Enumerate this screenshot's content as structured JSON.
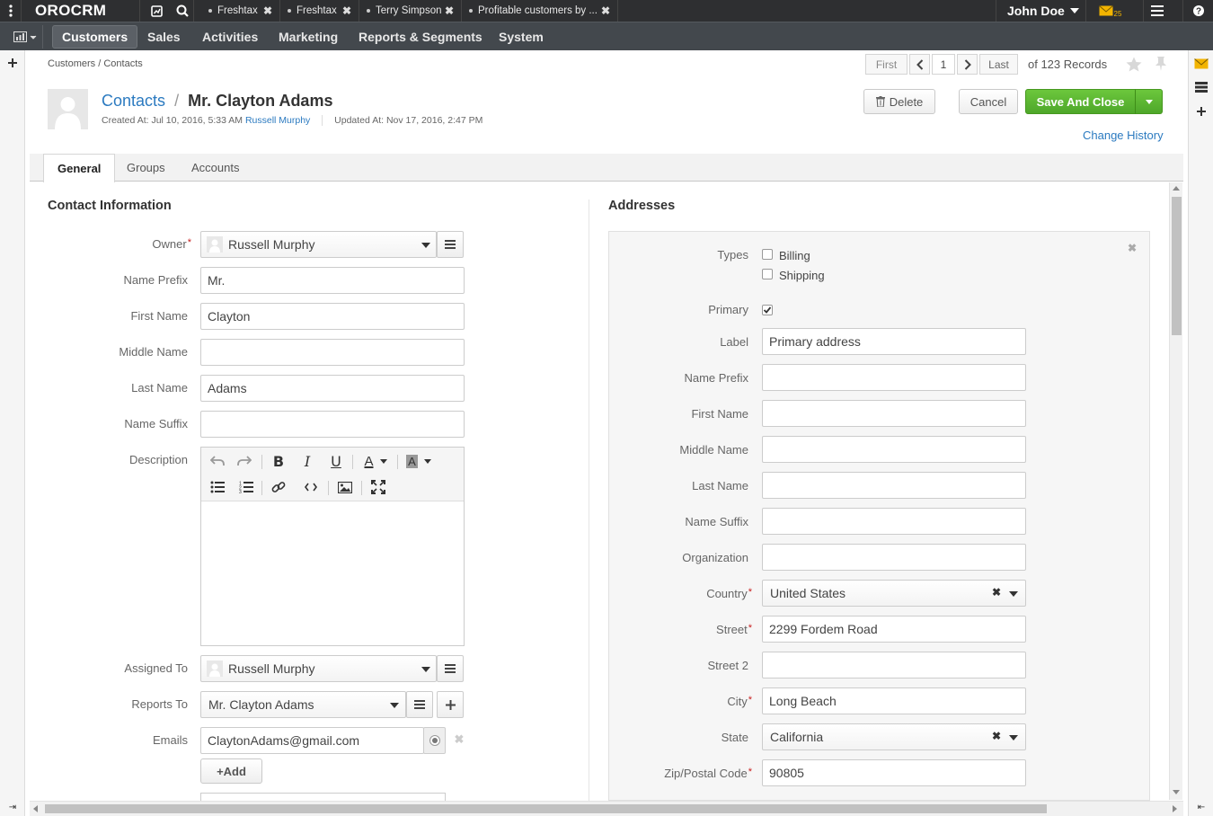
{
  "app": {
    "logo": "OROCRM",
    "user": "John Doe",
    "mail_count": "25"
  },
  "tabs": [
    {
      "label": "Freshtax"
    },
    {
      "label": "Freshtax"
    },
    {
      "label": "Terry Simpson"
    },
    {
      "label": "Profitable customers by ..."
    }
  ],
  "menu": [
    "Customers",
    "Sales",
    "Activities",
    "Marketing",
    "Reports & Segments",
    "System"
  ],
  "breadcrumb": "Customers / Contacts",
  "pager": {
    "first": "First",
    "page": "1",
    "last": "Last",
    "records": "of 123 Records"
  },
  "header": {
    "entity_link": "Contacts",
    "separator": "/",
    "name": "Mr. Clayton Adams",
    "created_label": "Created At: Jul 10, 2016, 5:33 AM",
    "created_by": "Russell Murphy",
    "updated_label": "Updated At: Nov 17, 2016, 2:47 PM"
  },
  "actions": {
    "delete": "Delete",
    "cancel": "Cancel",
    "save": "Save And Close",
    "change_history": "Change History"
  },
  "subtabs": [
    "General",
    "Groups",
    "Accounts"
  ],
  "contact": {
    "section_title": "Contact Information",
    "owner_label": "Owner",
    "owner": "Russell Murphy",
    "prefix_label": "Name Prefix",
    "prefix": "Mr.",
    "first_label": "First Name",
    "first": "Clayton",
    "middle_label": "Middle Name",
    "middle": "",
    "last_label": "Last Name",
    "last": "Adams",
    "suffix_label": "Name Suffix",
    "suffix": "",
    "description_label": "Description",
    "assigned_label": "Assigned To",
    "assigned": "Russell Murphy",
    "reports_label": "Reports To",
    "reports": "Mr. Clayton Adams",
    "emails_label": "Emails",
    "email": "ClaytonAdams@gmail.com",
    "add_label": "+Add"
  },
  "address": {
    "section_title": "Addresses",
    "types_label": "Types",
    "billing": "Billing",
    "shipping": "Shipping",
    "primary_label": "Primary",
    "label_label": "Label",
    "label": "Primary address",
    "prefix_label": "Name Prefix",
    "first_label": "First Name",
    "middle_label": "Middle Name",
    "last_label": "Last Name",
    "suffix_label": "Name Suffix",
    "org_label": "Organization",
    "country_label": "Country",
    "country": "United States",
    "street_label": "Street",
    "street": "2299 Fordem Road",
    "street2_label": "Street 2",
    "city_label": "City",
    "city": "Long Beach",
    "state_label": "State",
    "state": "California",
    "zip_label": "Zip/Postal Code",
    "zip": "90805"
  },
  "colors": {
    "accent": "#2b7ac0",
    "save": "#5bb531",
    "topbar": "#2e2f31",
    "menubar": "#43484d"
  }
}
